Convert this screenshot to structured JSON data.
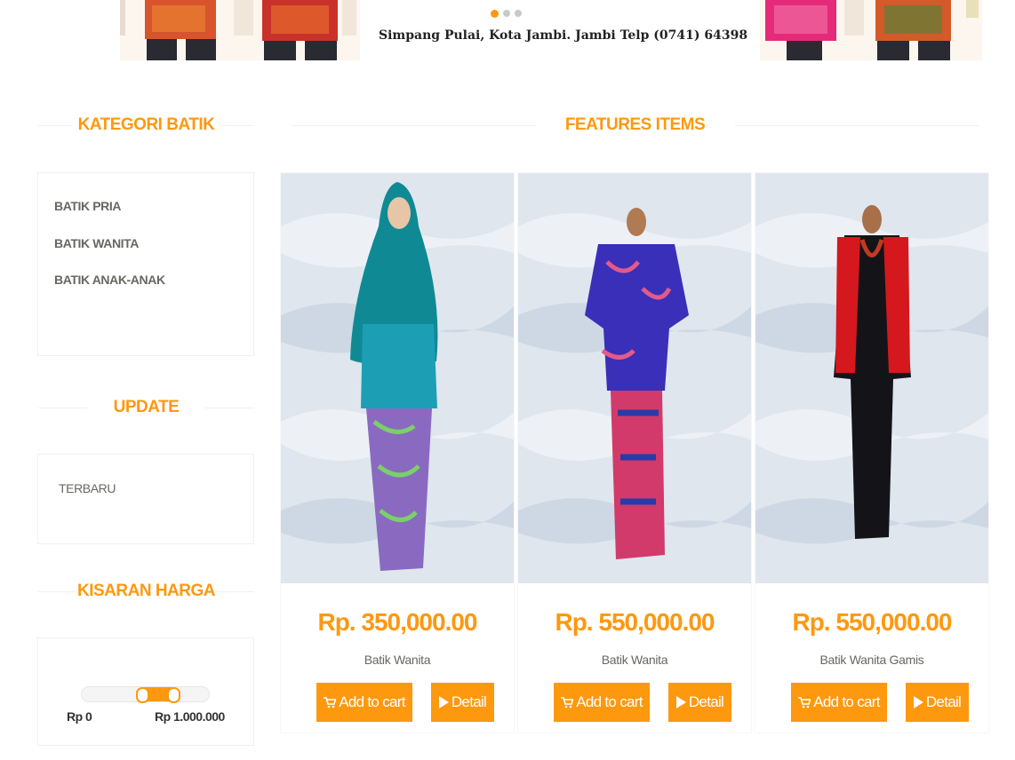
{
  "banner": {
    "address": "Simpang Pulai, Kota Jambi. Jambi Telp (0741) 64398",
    "active_slide": 1,
    "slide_count": 3
  },
  "sidebar": {
    "category_title": "KATEGORI BATIK",
    "categories": [
      "BATIK PRIA",
      "BATIK WANITA",
      "BATIK ANAK-ANAK"
    ],
    "update_title": "UPDATE",
    "update_items": [
      "TERBARU"
    ],
    "price_title": "KISARAN HARGA",
    "price_min_label": "Rp 0",
    "price_max_label": "Rp 1.000.000"
  },
  "main": {
    "title": "FEATURES ITEMS",
    "products": [
      {
        "price": "Rp. 350,000.00",
        "name": "Batik Wanita",
        "cart_label": "Add to cart",
        "detail_label": "Detail"
      },
      {
        "price": "Rp. 550,000.00",
        "name": "Batik Wanita",
        "cart_label": "Add to cart",
        "detail_label": "Detail"
      },
      {
        "price": "Rp. 550,000.00",
        "name": "Batik Wanita Gamis",
        "cart_label": "Add to cart",
        "detail_label": "Detail"
      }
    ]
  },
  "colors": {
    "accent": "#fe980f",
    "text": "#696763"
  }
}
